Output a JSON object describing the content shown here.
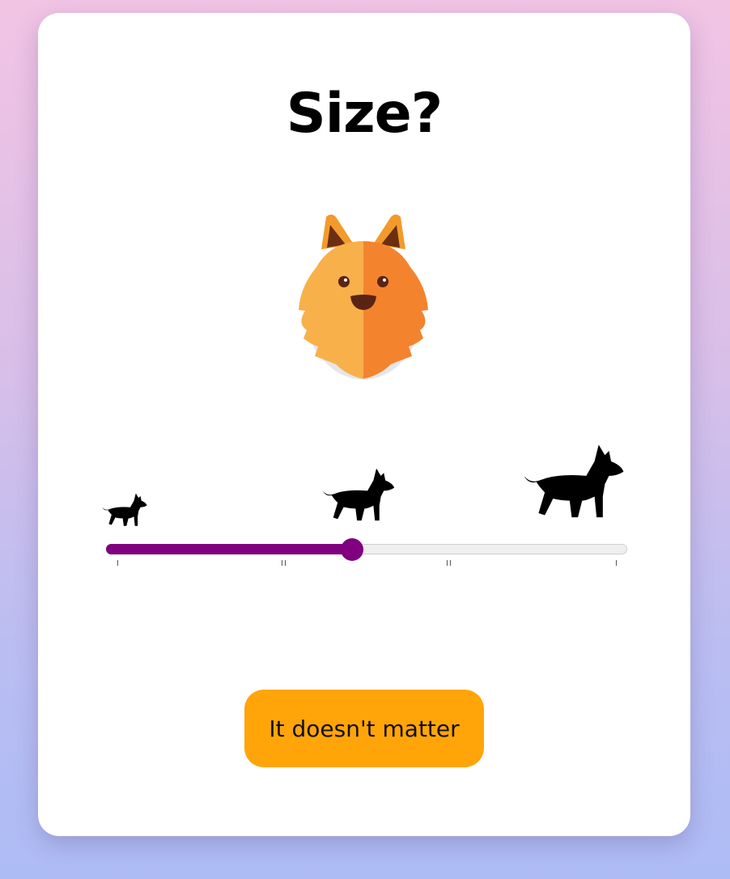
{
  "page": {
    "title": "Size?"
  },
  "hero": {
    "icon": "pomeranian-dog-face-icon"
  },
  "size_slider": {
    "options": [
      "small-dog-icon",
      "medium-dog-icon",
      "large-dog-icon"
    ],
    "value_fraction": 0.47,
    "tick_positions": [
      0,
      0.33,
      0.33,
      0.66,
      0.66,
      1
    ],
    "fill_color": "#800080",
    "track_color": "#efefef"
  },
  "actions": {
    "no_preference_label": "It doesn't matter",
    "button_color": "#ffa509"
  }
}
